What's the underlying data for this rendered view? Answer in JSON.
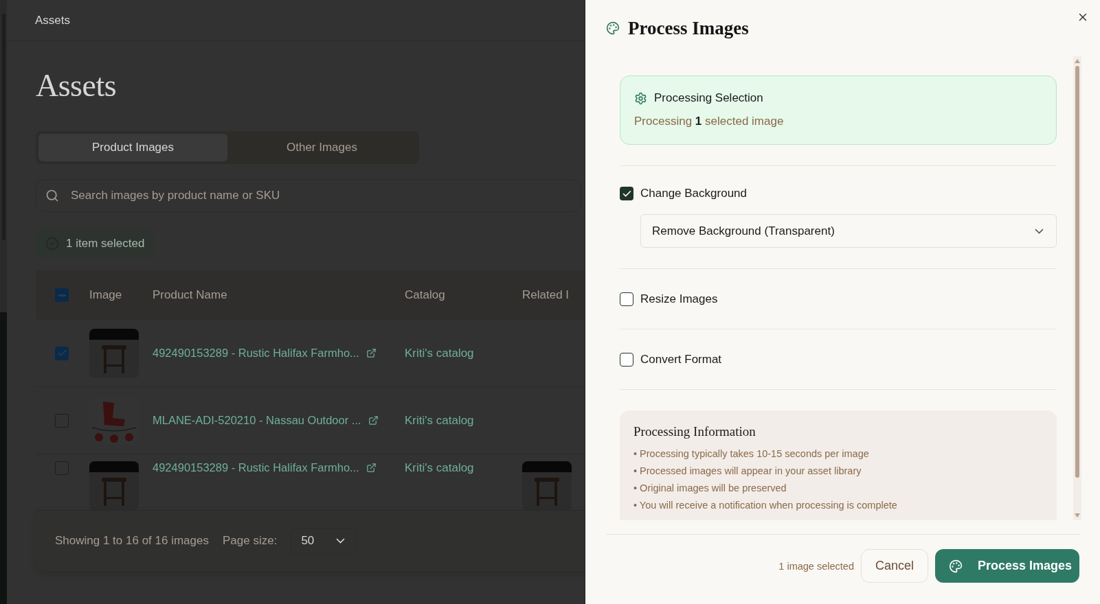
{
  "header": {
    "title": "Assets"
  },
  "page": {
    "heading": "Assets"
  },
  "tabs": [
    {
      "label": "Product Images",
      "selected": true
    },
    {
      "label": "Other Images",
      "selected": false
    }
  ],
  "search": {
    "placeholder": "Search images by product name or SKU"
  },
  "selection_badge": "1 item selected",
  "table": {
    "select_all": {
      "checked": true,
      "indeterminate": true
    },
    "columns": [
      "Image",
      "Product Name",
      "Catalog",
      "Related I"
    ],
    "rows": [
      {
        "checked": true,
        "name": "492490153289 - Rustic Halifax Farmho...",
        "catalog": "Kriti's catalog",
        "related_image": false
      },
      {
        "checked": false,
        "name": "MLANE-ADI-520210 - Nassau Outdoor ...",
        "catalog": "Kriti's catalog",
        "related_image": false
      },
      {
        "checked": false,
        "name": "492490153289 - Rustic Halifax Farmho...",
        "catalog": "Kriti's catalog",
        "related_image": true
      }
    ]
  },
  "footer": {
    "summary": "Showing 1 to 16 of 16 images",
    "page_size_label": "Page size:",
    "page_size": "50"
  },
  "drawer": {
    "title": "Process Images",
    "selection": {
      "title": "Processing Selection",
      "text": "Processing **1** selected image"
    },
    "options": [
      {
        "kind": "select",
        "label": "Change Background",
        "checked": true,
        "value": "Remove Background (Transparent)"
      },
      {
        "kind": "plain",
        "label": "Resize Images",
        "checked": false
      },
      {
        "kind": "plain",
        "label": "Convert Format",
        "checked": false
      }
    ],
    "info": {
      "title": "Processing Information",
      "items": [
        "• Processing typically takes 10-15 seconds per image",
        "• Processed images will appear in your asset library",
        "• Original images will be preserved",
        "• You will receive a notification when processing is complete"
      ]
    },
    "footer": {
      "count": "1 image selected",
      "cancel": "Cancel",
      "submit": "Process Images"
    }
  }
}
